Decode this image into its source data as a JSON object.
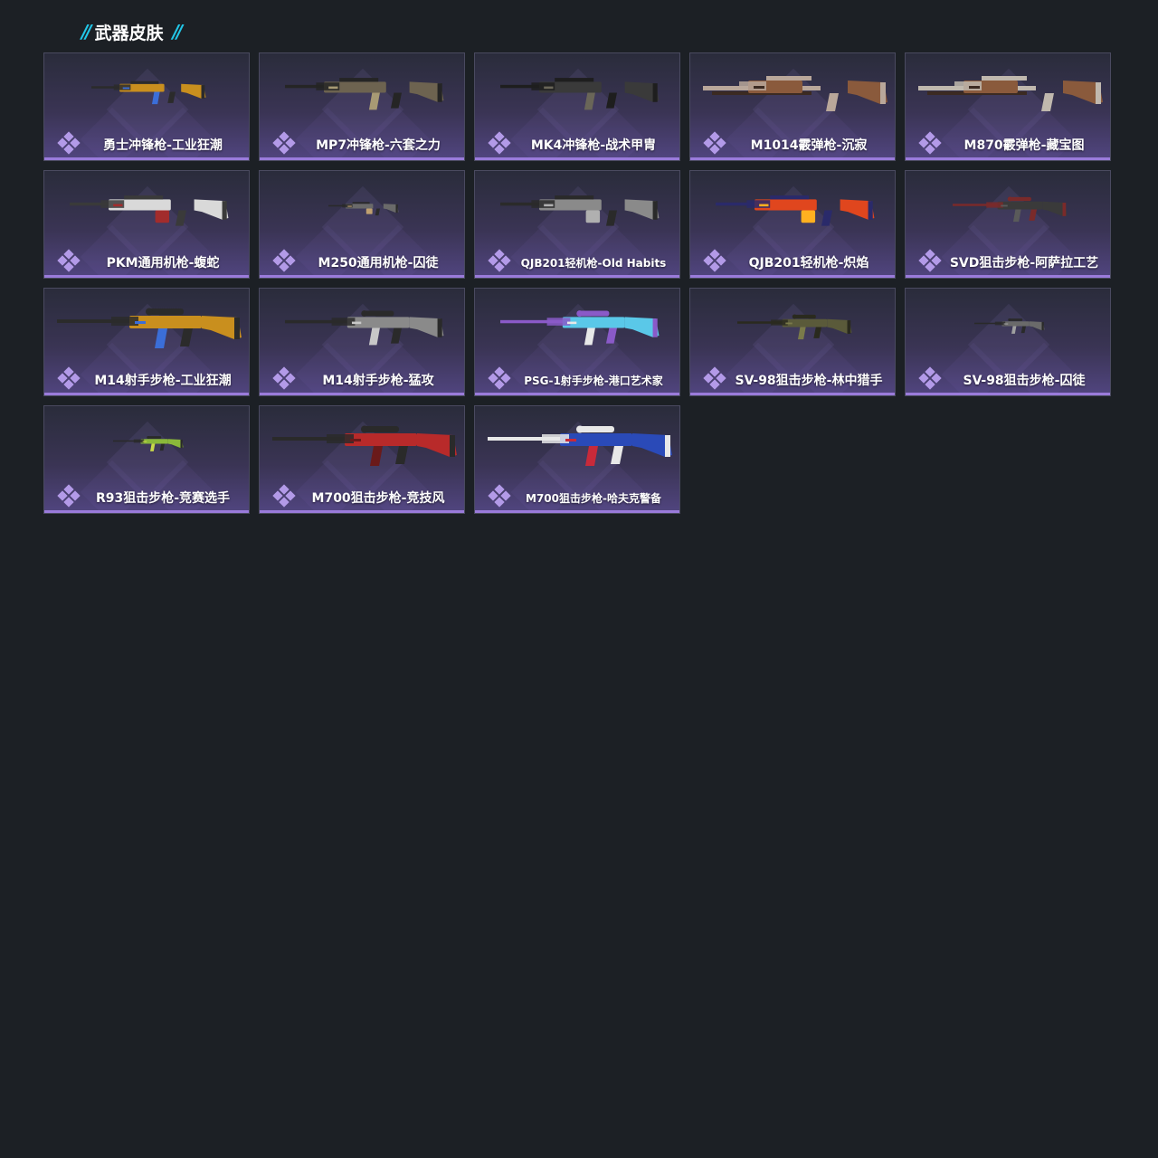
{
  "header": {
    "title": "武器皮肤"
  },
  "skins": [
    {
      "name": "勇士冲锋枪-工业狂潮",
      "icon": "smg-rifle-icon",
      "palette": [
        "#c98f1e",
        "#2b2b2b",
        "#3b6ed8"
      ],
      "size": "small",
      "label_size": "normal"
    },
    {
      "name": "MP7冲锋枪-六套之力",
      "icon": "smg-icon",
      "palette": [
        "#6d6350",
        "#252525",
        "#a89a74"
      ],
      "size": "normal",
      "label_size": "normal"
    },
    {
      "name": "MK4冲锋枪-战术甲胄",
      "icon": "assault-rifle-icon",
      "palette": [
        "#3a3a3a",
        "#1e1e1e",
        "#6a6658"
      ],
      "size": "normal",
      "label_size": "normal"
    },
    {
      "name": "M1014霰弹枪-沉寂",
      "icon": "shotgun-icon",
      "palette": [
        "#8a5a3c",
        "#b9a79a",
        "#3b2a22"
      ],
      "size": "long",
      "label_size": "normal"
    },
    {
      "name": "M870霰弹枪-藏宝图",
      "icon": "shotgun-icon",
      "palette": [
        "#8a5a3c",
        "#c0b8ae",
        "#3b2a22"
      ],
      "size": "long",
      "label_size": "normal"
    },
    {
      "name": "PKM通用机枪-蝮蛇",
      "icon": "machine-gun-icon",
      "palette": [
        "#d9d9d9",
        "#3a3a3a",
        "#a22c2c"
      ],
      "size": "normal",
      "label_size": "normal"
    },
    {
      "name": "M250通用机枪-囚徒",
      "icon": "machine-gun-icon",
      "palette": [
        "#6a6a6a",
        "#2a2a2a",
        "#c0a070"
      ],
      "size": "tiny",
      "label_size": "normal"
    },
    {
      "name": "QJB201轻机枪-Old Habits",
      "icon": "light-machine-gun-icon",
      "palette": [
        "#8a8a8a",
        "#2a2a2a",
        "#b0b0b0"
      ],
      "size": "normal",
      "label_size": "small"
    },
    {
      "name": "QJB201轻机枪-炽焰",
      "icon": "light-machine-gun-icon",
      "palette": [
        "#e0461e",
        "#2a2a6a",
        "#ffb020"
      ],
      "size": "normal",
      "label_size": "normal"
    },
    {
      "name": "SVD狙击步枪-阿萨拉工艺",
      "icon": "sniper-rifle-icon",
      "palette": [
        "#3a3a3a",
        "#7a2a2a",
        "#5a5a5a"
      ],
      "size": "small",
      "label_size": "normal"
    },
    {
      "name": "M14射手步枪-工业狂潮",
      "icon": "marksman-rifle-icon",
      "palette": [
        "#c98f1e",
        "#2b2b2b",
        "#3b6ed8"
      ],
      "size": "long",
      "label_size": "normal"
    },
    {
      "name": "M14射手步枪-猛攻",
      "icon": "marksman-rifle-icon",
      "palette": [
        "#8a8a8a",
        "#2a2a2a",
        "#c8c8c8"
      ],
      "size": "normal",
      "label_size": "normal"
    },
    {
      "name": "PSG-1射手步枪-港口艺术家",
      "icon": "marksman-rifle-icon",
      "palette": [
        "#5ac8e8",
        "#8a5ac8",
        "#e8e8e8"
      ],
      "size": "normal",
      "label_size": "small"
    },
    {
      "name": "SV-98狙击步枪-林中猎手",
      "icon": "sniper-rifle-icon",
      "palette": [
        "#5a5a3a",
        "#2a2a1e",
        "#7a7a4a"
      ],
      "size": "small",
      "label_size": "normal"
    },
    {
      "name": "SV-98狙击步枪-囚徒",
      "icon": "sniper-rifle-icon",
      "palette": [
        "#6a6a6a",
        "#2a2a2a",
        "#a0a0a0"
      ],
      "size": "tiny",
      "label_size": "normal"
    },
    {
      "name": "R93狙击步枪-竞赛选手",
      "icon": "sniper-rifle-icon",
      "palette": [
        "#8ab83a",
        "#2a2a2a",
        "#c8d84a"
      ],
      "size": "tiny",
      "label_size": "normal"
    },
    {
      "name": "M700狙击步枪-竞技风",
      "icon": "sniper-rifle-icon",
      "palette": [
        "#b82a2a",
        "#2a2a2a",
        "#6a1a1a"
      ],
      "size": "long",
      "label_size": "normal"
    },
    {
      "name": "M700狙击步枪-哈夫克警备",
      "icon": "sniper-rifle-icon",
      "palette": [
        "#2a4ab8",
        "#e8e8e8",
        "#c82a3a"
      ],
      "size": "long",
      "label_size": "small"
    }
  ]
}
